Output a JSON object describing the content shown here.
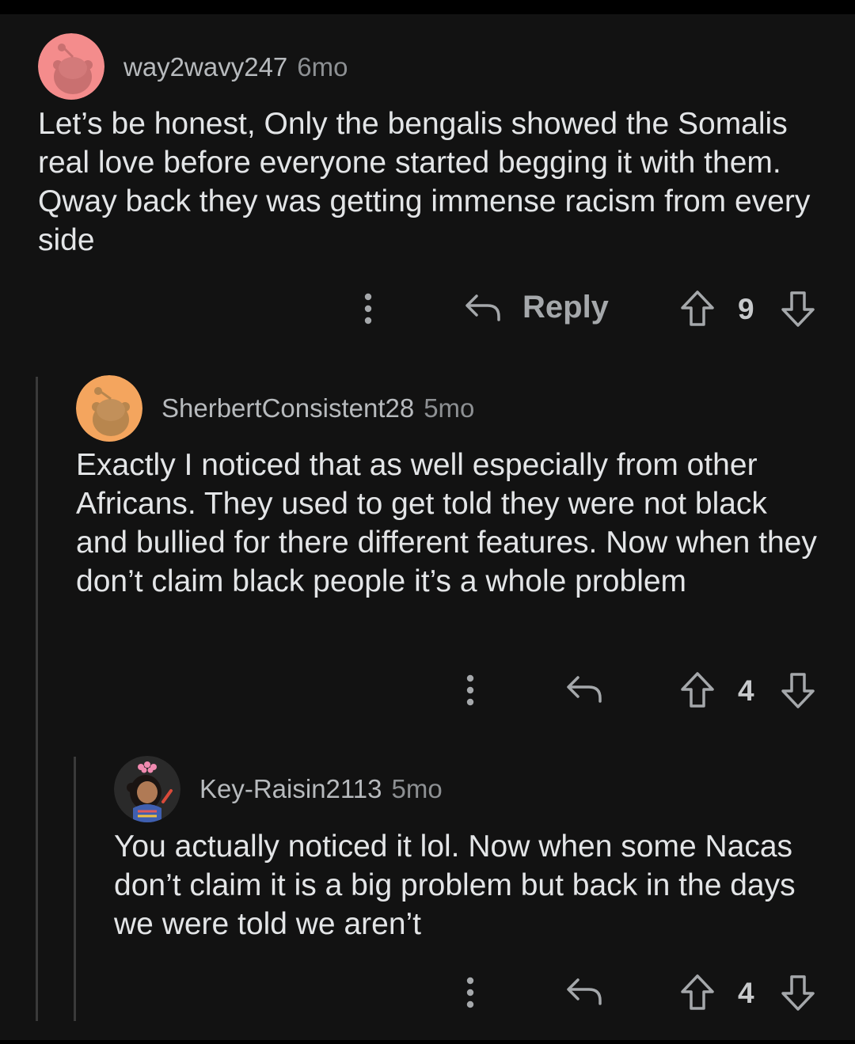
{
  "comments": [
    {
      "username": "way2wavy247",
      "age": "6mo",
      "avatar_color": "#f48c8c",
      "text": "Let’s be honest, Only the bengalis showed the Somalis real love before everyone started begging it with them. Qway back they was getting immense racism from every side",
      "reply_label": "Reply",
      "score": "9",
      "icons": [
        "more-vertical-icon",
        "reply-arrow-icon",
        "upvote-arrow-icon",
        "downvote-arrow-icon"
      ]
    },
    {
      "username": "SherbertConsistent28",
      "age": "5mo",
      "avatar_color": "#f4a55e",
      "text": "Exactly I noticed that as well especially from other Africans. They used to get told they were not black and bullied for there different features. Now when they don’t claim black people it’s a whole problem",
      "score": "4",
      "icons": [
        "more-vertical-icon",
        "reply-arrow-icon",
        "upvote-arrow-icon",
        "downvote-arrow-icon"
      ]
    },
    {
      "username": "Key-Raisin2113",
      "age": "5mo",
      "avatar_color": "#2a2a2a",
      "text": "You actually noticed it lol. Now when some Nacas don’t claim it is a big problem but back in the days we were told we aren’t",
      "score": "4",
      "icons": [
        "more-vertical-icon",
        "reply-arrow-icon",
        "upvote-arrow-icon",
        "downvote-arrow-icon"
      ]
    }
  ],
  "colors": {
    "background": "#121212",
    "text": "#e3e5e7",
    "muted": "#a5a8ab",
    "thread_line": "#3a3a3a"
  }
}
